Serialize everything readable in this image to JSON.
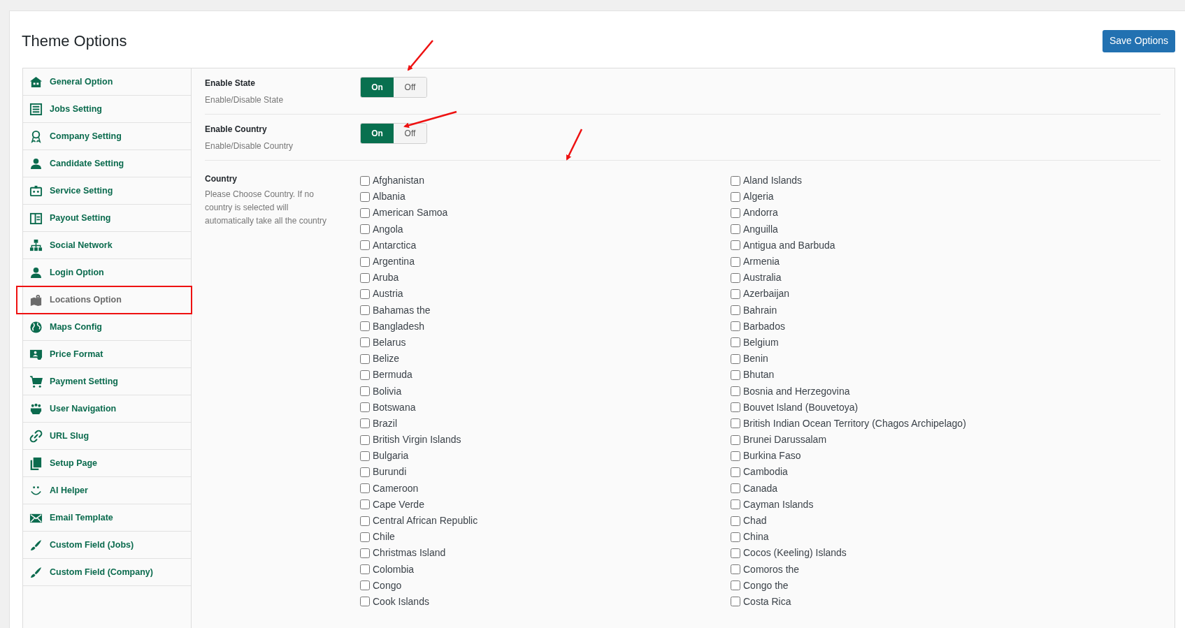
{
  "page": {
    "title": "Theme Options",
    "save_button": "Save Options"
  },
  "sidebar": {
    "items": [
      {
        "label": "General Option",
        "selected": false
      },
      {
        "label": "Jobs Setting",
        "selected": false
      },
      {
        "label": "Company Setting",
        "selected": false
      },
      {
        "label": "Candidate Setting",
        "selected": false
      },
      {
        "label": "Service Setting",
        "selected": false
      },
      {
        "label": "Payout Setting",
        "selected": false
      },
      {
        "label": "Social Network",
        "selected": false
      },
      {
        "label": "Login Option",
        "selected": false
      },
      {
        "label": "Locations Option",
        "selected": true
      },
      {
        "label": "Maps Config",
        "selected": false
      },
      {
        "label": "Price Format",
        "selected": false
      },
      {
        "label": "Payment Setting",
        "selected": false
      },
      {
        "label": "User Navigation",
        "selected": false
      },
      {
        "label": "URL Slug",
        "selected": false
      },
      {
        "label": "Setup Page",
        "selected": false
      },
      {
        "label": "AI Helper",
        "selected": false
      },
      {
        "label": "Email Template",
        "selected": false
      },
      {
        "label": "Custom Field (Jobs)",
        "selected": false
      },
      {
        "label": "Custom Field (Company)",
        "selected": false
      }
    ]
  },
  "settings": [
    {
      "label": "Enable State",
      "description": "Enable/Disable State",
      "on_label": "On",
      "off_label": "Off",
      "on": true
    },
    {
      "label": "Enable Country",
      "description": "Enable/Disable Country",
      "on_label": "On",
      "off_label": "Off",
      "on": true
    }
  ],
  "country": {
    "label": "Country",
    "description": "Please Choose Country. If no country is selected will automatically take all the country",
    "column_1": [
      {
        "name": "Afghanistan",
        "checked": false
      },
      {
        "name": "Albania",
        "checked": false
      },
      {
        "name": "American Samoa",
        "checked": false
      },
      {
        "name": "Angola",
        "checked": false
      },
      {
        "name": "Antarctica",
        "checked": false
      },
      {
        "name": "Argentina",
        "checked": false
      },
      {
        "name": "Aruba",
        "checked": false
      },
      {
        "name": "Austria",
        "checked": false
      },
      {
        "name": "Bahamas the",
        "checked": false
      },
      {
        "name": "Bangladesh",
        "checked": false
      },
      {
        "name": "Belarus",
        "checked": false
      },
      {
        "name": "Belize",
        "checked": false
      },
      {
        "name": "Bermuda",
        "checked": false
      },
      {
        "name": "Bolivia",
        "checked": false
      },
      {
        "name": "Botswana",
        "checked": false
      },
      {
        "name": "Brazil",
        "checked": false
      },
      {
        "name": "British Virgin Islands",
        "checked": false
      },
      {
        "name": "Bulgaria",
        "checked": false
      },
      {
        "name": "Burundi",
        "checked": false
      },
      {
        "name": "Cameroon",
        "checked": false
      },
      {
        "name": "Cape Verde",
        "checked": false
      },
      {
        "name": "Central African Republic",
        "checked": false
      },
      {
        "name": "Chile",
        "checked": false
      },
      {
        "name": "Christmas Island",
        "checked": false
      },
      {
        "name": "Colombia",
        "checked": false
      },
      {
        "name": "Congo",
        "checked": false
      },
      {
        "name": "Cook Islands",
        "checked": false
      }
    ],
    "column_2": [
      {
        "name": "Aland Islands",
        "checked": false
      },
      {
        "name": "Algeria",
        "checked": false
      },
      {
        "name": "Andorra",
        "checked": false
      },
      {
        "name": "Anguilla",
        "checked": false
      },
      {
        "name": "Antigua and Barbuda",
        "checked": false
      },
      {
        "name": "Armenia",
        "checked": false
      },
      {
        "name": "Australia",
        "checked": false
      },
      {
        "name": "Azerbaijan",
        "checked": false
      },
      {
        "name": "Bahrain",
        "checked": false
      },
      {
        "name": "Barbados",
        "checked": false
      },
      {
        "name": "Belgium",
        "checked": false
      },
      {
        "name": "Benin",
        "checked": false
      },
      {
        "name": "Bhutan",
        "checked": false
      },
      {
        "name": "Bosnia and Herzegovina",
        "checked": false
      },
      {
        "name": "Bouvet Island (Bouvetoya)",
        "checked": false
      },
      {
        "name": "British Indian Ocean Territory (Chagos Archipelago)",
        "checked": false
      },
      {
        "name": "Brunei Darussalam",
        "checked": false
      },
      {
        "name": "Burkina Faso",
        "checked": false
      },
      {
        "name": "Cambodia",
        "checked": false
      },
      {
        "name": "Canada",
        "checked": false
      },
      {
        "name": "Cayman Islands",
        "checked": false
      },
      {
        "name": "Chad",
        "checked": false
      },
      {
        "name": "China",
        "checked": false
      },
      {
        "name": "Cocos (Keeling) Islands",
        "checked": false
      },
      {
        "name": "Comoros the",
        "checked": false
      },
      {
        "name": "Congo the",
        "checked": false
      },
      {
        "name": "Costa Rica",
        "checked": false
      }
    ]
  }
}
